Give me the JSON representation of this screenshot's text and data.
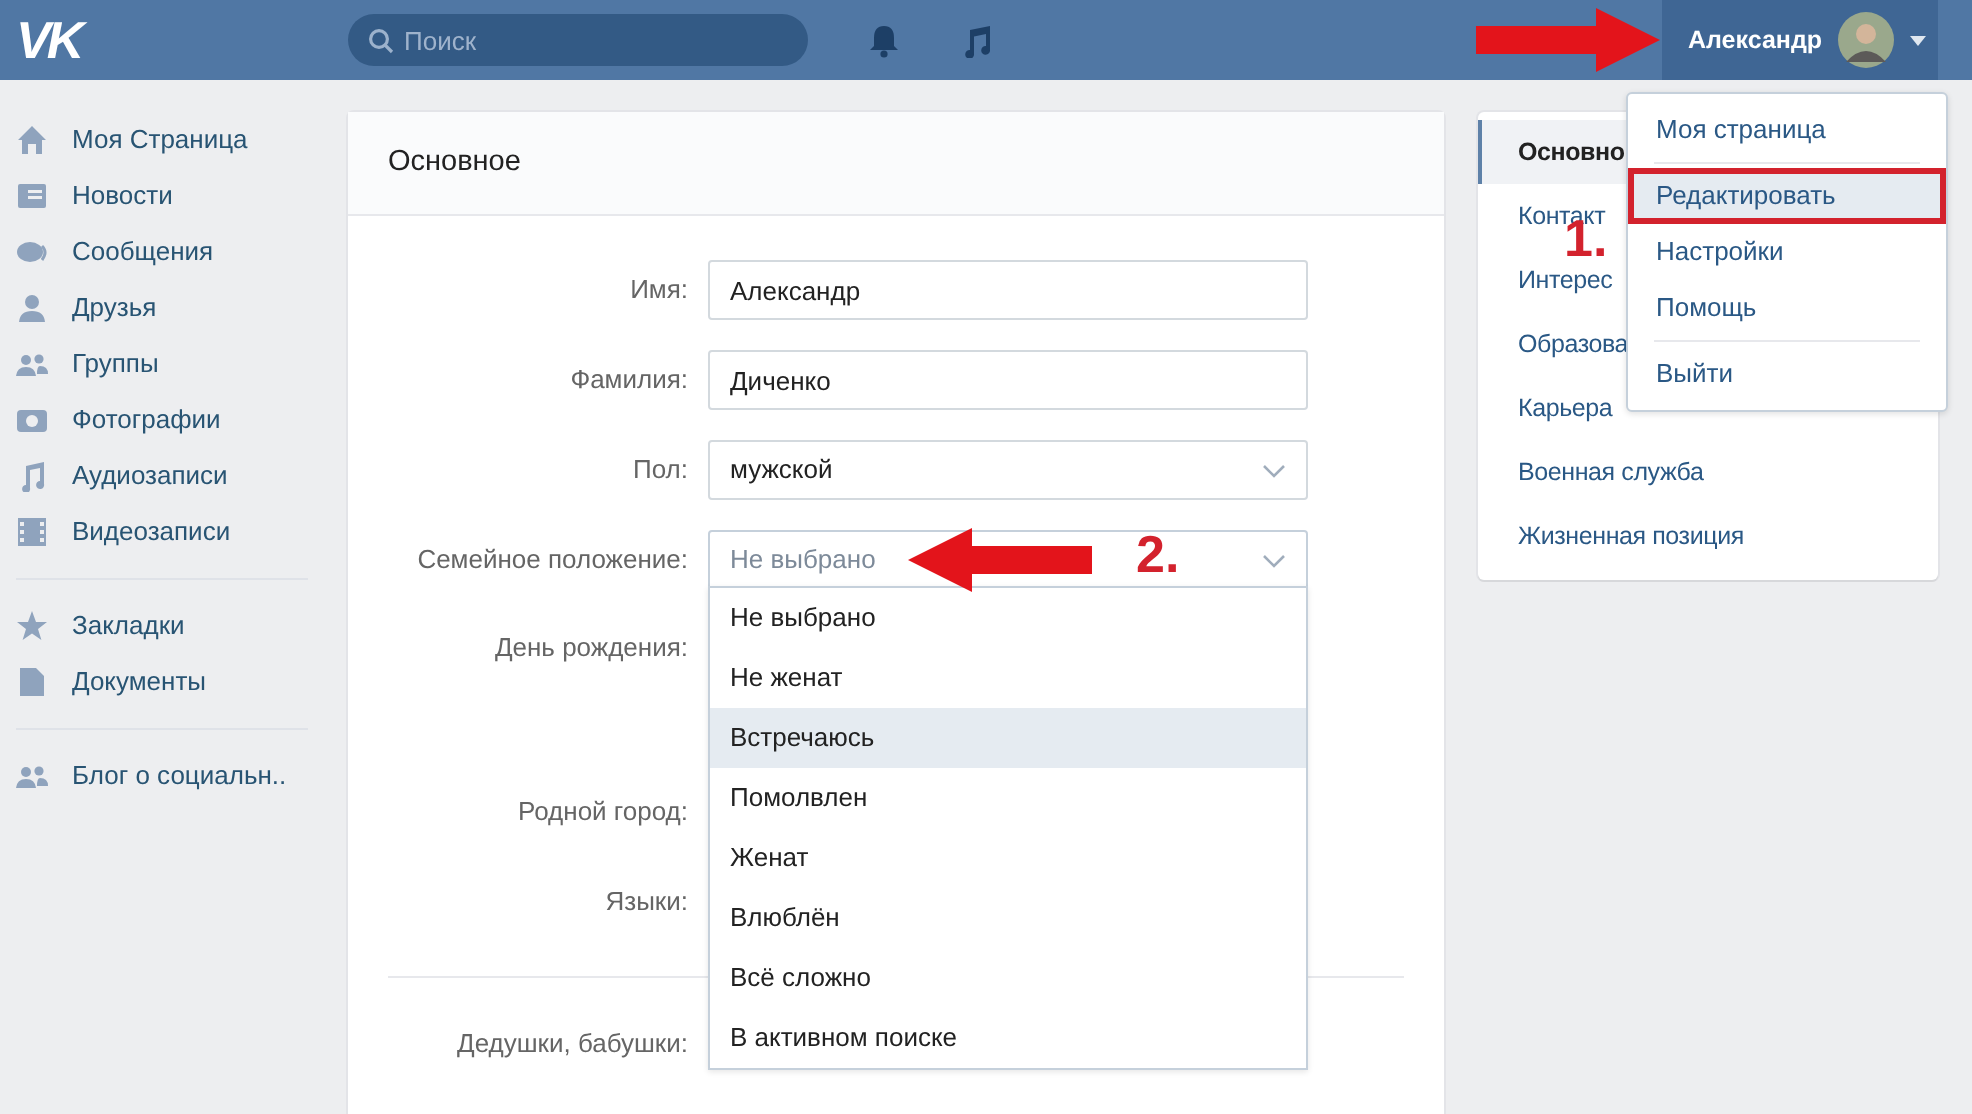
{
  "header": {
    "logo": "VK",
    "search": {
      "placeholder": "Поиск"
    },
    "user": {
      "name": "Александр",
      "menu_open": true
    }
  },
  "sidebar": {
    "groups": [
      [
        {
          "label": "Моя Страница"
        },
        {
          "label": "Новости"
        },
        {
          "label": "Сообщения"
        },
        {
          "label": "Друзья"
        },
        {
          "label": "Группы"
        },
        {
          "label": "Фотографии"
        },
        {
          "label": "Аудиозаписи"
        },
        {
          "label": "Видеозаписи"
        }
      ],
      [
        {
          "label": "Закладки"
        },
        {
          "label": "Документы"
        }
      ],
      [
        {
          "label": "Блог о социальн.."
        }
      ]
    ]
  },
  "form": {
    "title": "Основное",
    "fields": [
      {
        "label": "Имя:",
        "kind": "text",
        "value": "Александр"
      },
      {
        "label": "Фамилия:",
        "kind": "text",
        "value": "Диченко"
      },
      {
        "label": "Пол:",
        "kind": "select",
        "value": "мужской"
      },
      {
        "label": "Семейное положение:",
        "kind": "select",
        "placeholder": "Не выбрано",
        "open": true,
        "options": [
          {
            "label": "Не выбрано",
            "selected": false
          },
          {
            "label": "Не женат",
            "selected": false
          },
          {
            "label": "Встречаюсь",
            "selected": true
          },
          {
            "label": "Помолвлен",
            "selected": false
          },
          {
            "label": "Женат",
            "selected": false
          },
          {
            "label": "Влюблён",
            "selected": false
          },
          {
            "label": "Всё сложно",
            "selected": false
          },
          {
            "label": "В активном поиске",
            "selected": false
          }
        ]
      }
    ],
    "covered_labels": [
      "День рождения:",
      "Родной город:",
      "Языки:"
    ],
    "after_divider_label": "Дедушки, бабушки:"
  },
  "section_menu": [
    {
      "label": "Основно",
      "selected": true
    },
    {
      "label": "Контакт",
      "selected": false
    },
    {
      "label": "Интерес",
      "selected": false
    },
    {
      "label": "Образова",
      "selected": false
    },
    {
      "label": "Карьера",
      "selected": false
    },
    {
      "label": "Военная служба",
      "selected": false
    },
    {
      "label": "Жизненная позиция",
      "selected": false
    }
  ],
  "user_menu": [
    {
      "label": "Моя страница",
      "highlighted": false
    },
    {
      "label": "Редактировать",
      "highlighted": true
    },
    {
      "label": "Настройки",
      "highlighted": false
    },
    {
      "label": "Помощь",
      "highlighted": false
    },
    {
      "label": "Выйти",
      "highlighted": false
    }
  ],
  "annotations": [
    {
      "label": "1."
    },
    {
      "label": "2."
    }
  ]
}
